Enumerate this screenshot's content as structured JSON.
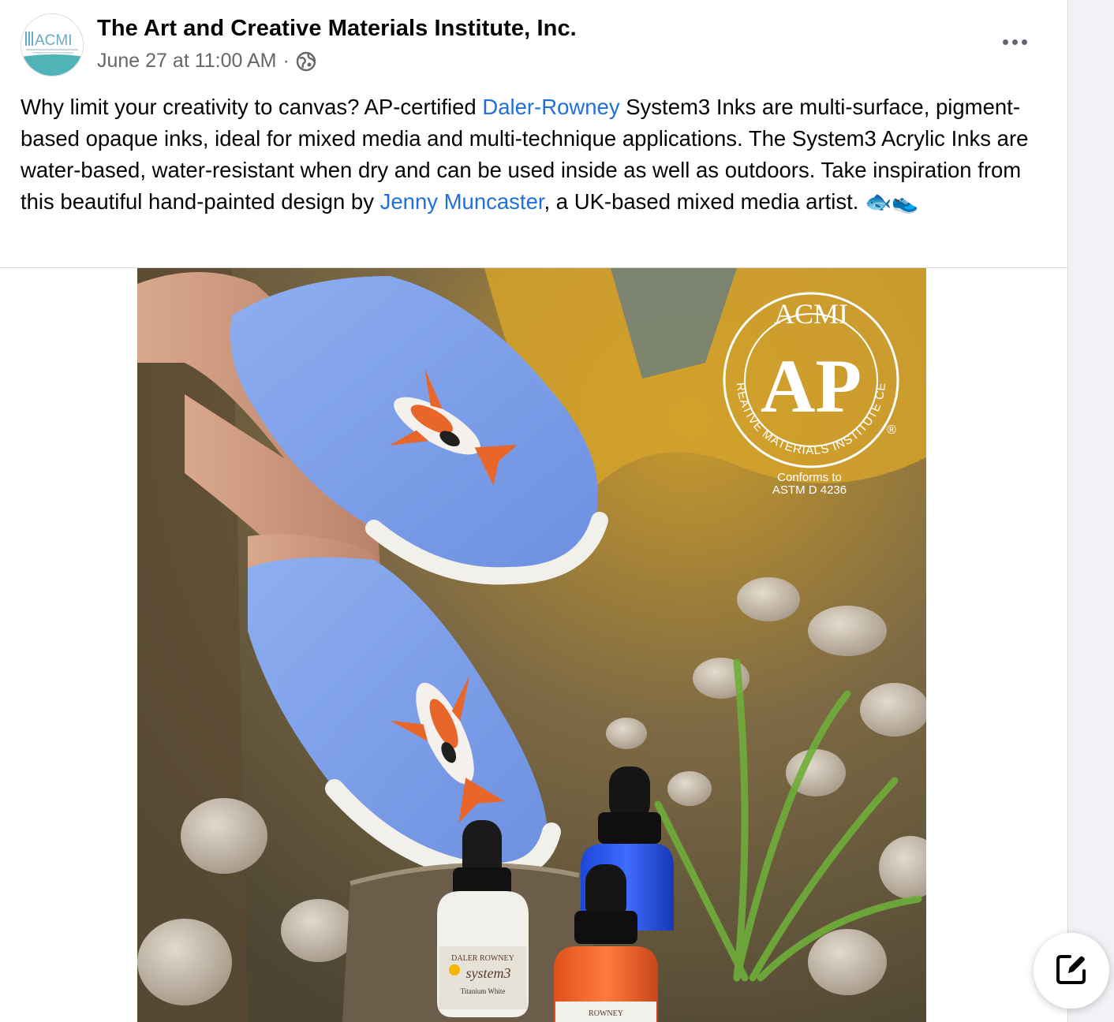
{
  "post": {
    "author": "The Art and Creative Materials Institute, Inc.",
    "timestamp": "June 27 at 11:00 AM",
    "separator": "·",
    "privacy_icon": "globe-icon",
    "more_icon": "more-options-icon",
    "avatar_text": "ACMI",
    "text": {
      "p1": "Why limit your creativity to canvas? AP-certified ",
      "link1": "Daler-Rowney",
      "p2": " System3 Inks are multi-surface, pigment-based opaque inks, ideal for mixed media and multi-technique applications. The System3 Acrylic Inks are water-based, water-resistant when dry and can be used inside as well as outdoors. Take inspiration from this beautiful hand-painted design by ",
      "link2": "Jenny Muncaster",
      "p3": ", a UK-based mixed media artist. ",
      "emoji": "🐟👟"
    }
  },
  "photo": {
    "seal": {
      "top": "ACMI",
      "center": "AP",
      "ring": "ART & CREATIVE MATERIALS INSTITUTE CERTIFIED",
      "registered": "®",
      "conforms_line1": "Conforms to",
      "conforms_line2": "ASTM D 4236"
    },
    "bottle_labels": {
      "white_brand": "DALER ROWNEY",
      "white_product": "system3",
      "white_color": "Titanium White",
      "orange_brand": "ROWNEY"
    }
  },
  "compose": {
    "icon": "compose-icon"
  },
  "colors": {
    "link": "#216fdb",
    "meta": "#65676b",
    "shoe_blue": "#7b9ee6",
    "accent_orange": "#e8662a"
  }
}
